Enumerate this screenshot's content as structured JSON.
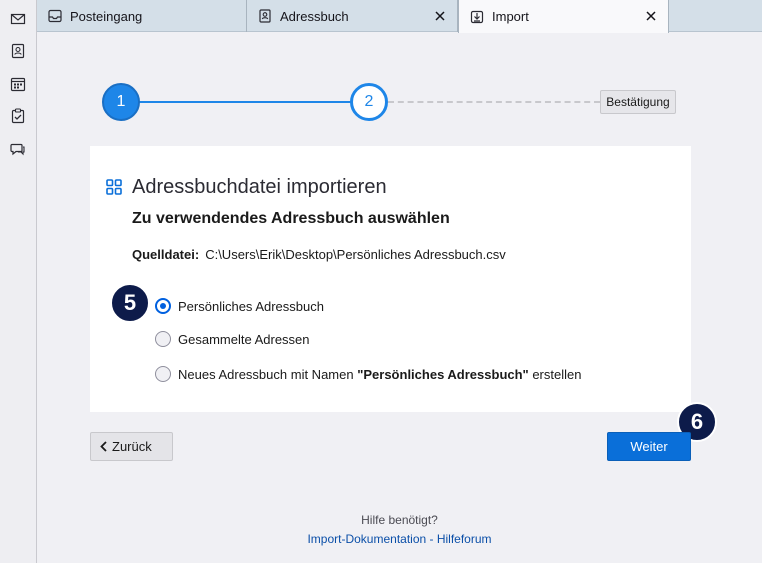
{
  "tabs": [
    {
      "label": "Posteingang",
      "icon": "inbox-icon"
    },
    {
      "label": "Adressbuch",
      "icon": "address-book-icon"
    },
    {
      "label": "Import",
      "icon": "import-icon"
    }
  ],
  "spaces": [
    "mail-icon",
    "address-book-icon",
    "calendar-icon",
    "tasks-icon",
    "chat-icon"
  ],
  "stepper": {
    "step1": "1",
    "step2": "2",
    "final_label": "Bestätigung"
  },
  "card": {
    "title": "Adressbuchdatei importieren",
    "subtitle": "Zu verwendendes Adressbuch auswählen",
    "source_label": "Quelldatei:",
    "source_path": "C:\\Users\\Erik\\Desktop\\Persönliches Adressbuch.csv",
    "options": [
      {
        "label": "Persönliches Adressbuch",
        "checked": true
      },
      {
        "label": "Gesammelte Adressen",
        "checked": false
      },
      {
        "prefix": "Neues Adressbuch mit Namen ",
        "quoted": "\"Persönliches Adressbuch\"",
        "suffix": " erstellen",
        "checked": false
      }
    ]
  },
  "badges": {
    "first": "5",
    "second": "6"
  },
  "buttons": {
    "back": "Zurück",
    "next": "Weiter"
  },
  "help": {
    "question": "Hilfe benötigt?",
    "doc_link": "Import-Dokumentation",
    "separator": " - ",
    "forum_link": "Hilfeforum"
  },
  "colors": {
    "accent": "#0a6fd9",
    "badge": "#0d1b4a"
  }
}
